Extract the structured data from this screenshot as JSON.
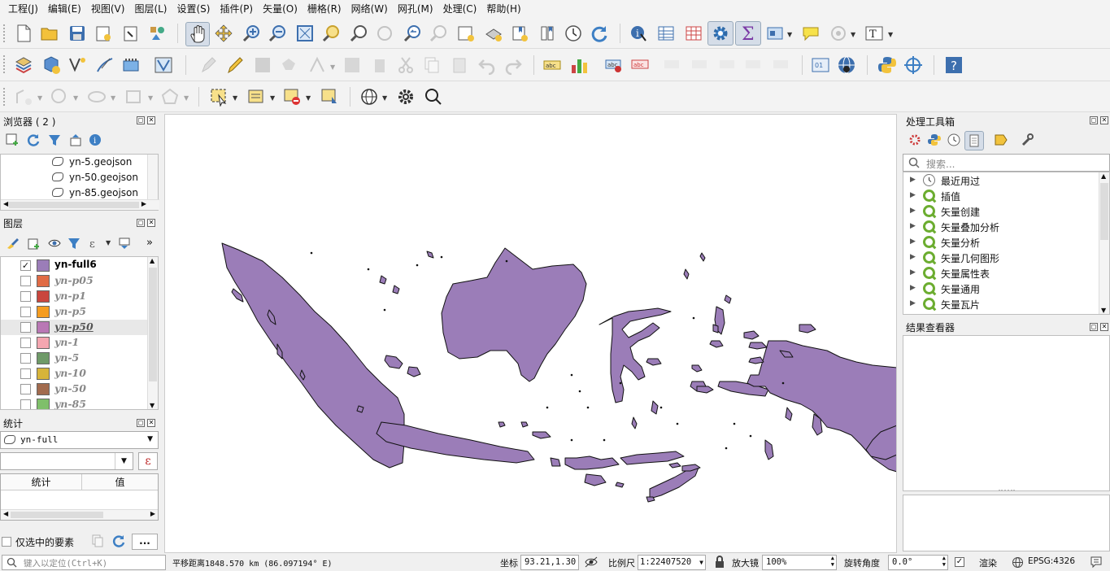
{
  "menu": [
    "工程(J)",
    "编辑(E)",
    "视图(V)",
    "图层(L)",
    "设置(S)",
    "插件(P)",
    "矢量(O)",
    "栅格(R)",
    "网络(W)",
    "网孔(M)",
    "处理(C)",
    "帮助(H)"
  ],
  "browser": {
    "title": "浏览器 ( 2 )",
    "items": [
      "yn-5.geojson",
      "yn-50.geojson",
      "yn-85.geojson"
    ]
  },
  "layers": {
    "title": "图层",
    "items": [
      {
        "name": "yn-full6",
        "color": "#9b7db8",
        "checked": true
      },
      {
        "name": "yn-p05",
        "color": "#e06b45",
        "checked": false
      },
      {
        "name": "yn-p1",
        "color": "#c9463d",
        "checked": false
      },
      {
        "name": "yn-p5",
        "color": "#f59c1f",
        "checked": false
      },
      {
        "name": "yn-p50",
        "color": "#b978b5",
        "checked": false
      },
      {
        "name": "yn-1",
        "color": "#f4a6b0",
        "checked": false
      },
      {
        "name": "yn-5",
        "color": "#6f9a68",
        "checked": false
      },
      {
        "name": "yn-10",
        "color": "#d7b43a",
        "checked": false
      },
      {
        "name": "yn-50",
        "color": "#a26b4e",
        "checked": false
      },
      {
        "name": "yn-85",
        "color": "#7fbf6a",
        "checked": false
      }
    ]
  },
  "stats": {
    "title": "统计",
    "layer_select": "yn-full",
    "col_stat": "统计",
    "col_value": "值",
    "selected_only": "仅选中的要素",
    "more": "..."
  },
  "toolbox": {
    "title": "处理工具箱",
    "search_placeholder": "搜索...",
    "groups": [
      "最近用过",
      "插值",
      "矢量创建",
      "矢量叠加分析",
      "矢量分析",
      "矢量几何图形",
      "矢量属性表",
      "矢量通用",
      "矢量瓦片"
    ]
  },
  "results": {
    "title": "结果查看器"
  },
  "status": {
    "locate_placeholder": "键入以定位(Ctrl+K)",
    "measure": "平移距离1848.570 km (86.097194° E)",
    "coord_label": "坐标",
    "coord": "93.21,1.30",
    "scale_label": "比例尺",
    "scale": "1:22407520",
    "magnifier_label": "放大镜",
    "magnifier": "100%",
    "rotation_label": "旋转角度",
    "rotation": "0.0°",
    "render_label": "渲染",
    "crs": "EPSG:4326"
  },
  "colors": {
    "map_fill": "#9b7db8",
    "accent": "#3f7fc0"
  }
}
